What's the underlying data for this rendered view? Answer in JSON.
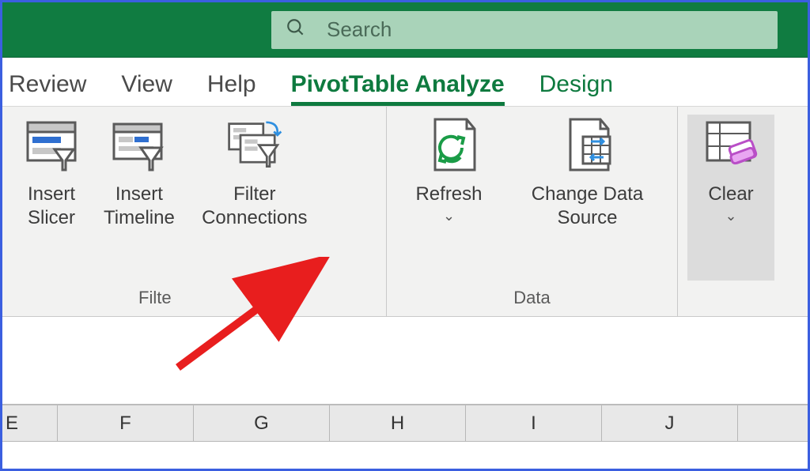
{
  "search": {
    "placeholder": "Search"
  },
  "tabs": {
    "review": "Review",
    "view": "View",
    "help": "Help",
    "analyze": "PivotTable Analyze",
    "design": "Design"
  },
  "ribbon": {
    "filter": {
      "slicer": "Insert\nSlicer",
      "timeline": "Insert\nTimeline",
      "connections": "Filter\nConnections",
      "group_label": "Filte"
    },
    "data": {
      "refresh": "Refresh",
      "change_source": "Change Data\nSource",
      "group_label": "Data"
    },
    "actions": {
      "clear": "Clear"
    }
  },
  "columns": [
    "E",
    "F",
    "G",
    "H",
    "I",
    "J"
  ]
}
